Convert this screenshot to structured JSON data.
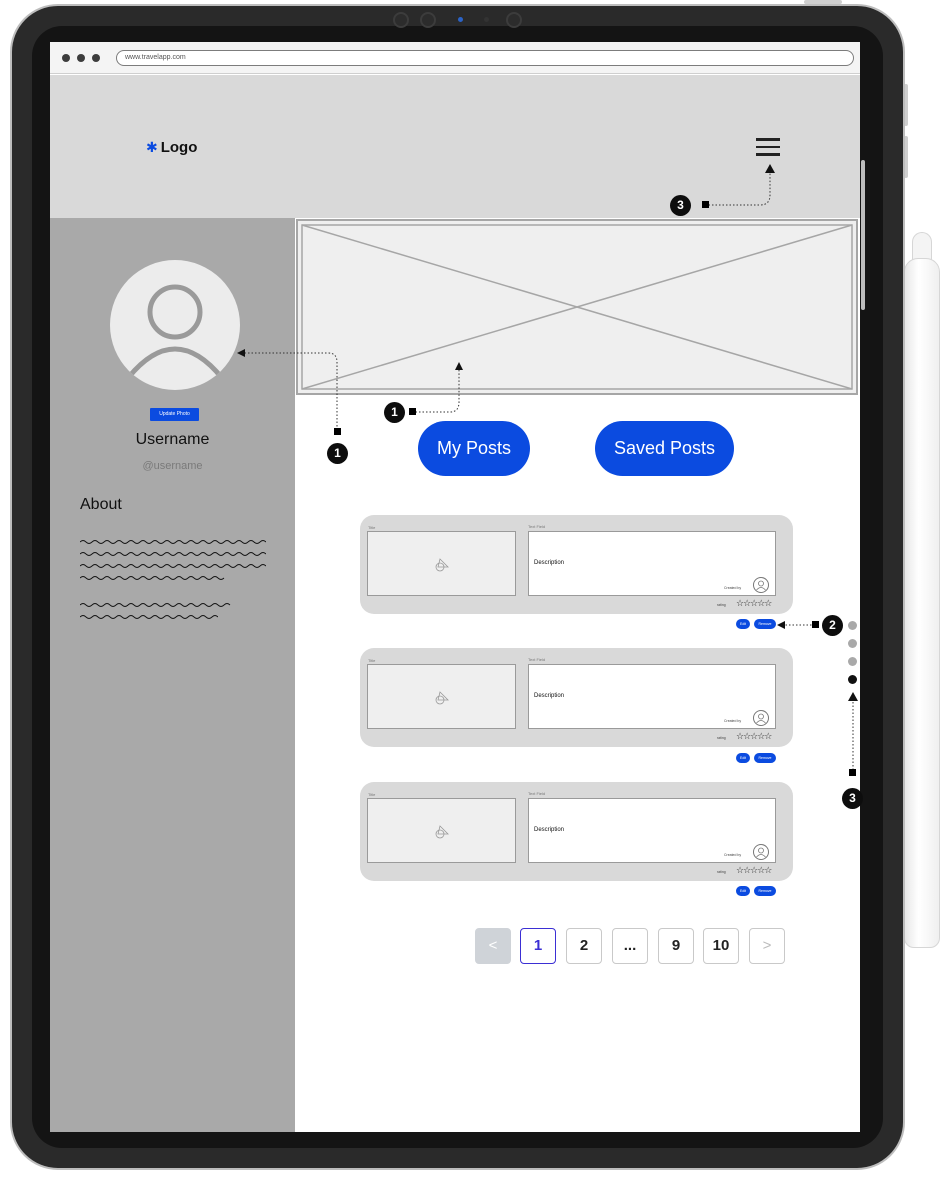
{
  "browser": {
    "url": "www.travelapp.com"
  },
  "header": {
    "logo_text": "Logo",
    "logo_icon": "asterisk-icon",
    "menu_icon": "hamburger-icon"
  },
  "sidebar": {
    "update_photo_label": "Update Photo",
    "username": "Username",
    "handle": "@username",
    "about_heading": "About"
  },
  "tabs": {
    "my_posts": "My Posts",
    "saved_posts": "Saved Posts"
  },
  "cards": [
    {
      "title_label": "Title",
      "text_field_label": "Text Field",
      "description": "Description",
      "created_by": "Created by",
      "rating_label": "rating",
      "stars": "☆☆☆☆☆",
      "edit_label": "Edit",
      "remove_label": "Remove"
    },
    {
      "title_label": "Title",
      "text_field_label": "Text Field",
      "description": "Description",
      "created_by": "Created by",
      "rating_label": "rating",
      "stars": "☆☆☆☆☆",
      "edit_label": "Edit",
      "remove_label": "Remove"
    },
    {
      "title_label": "Title",
      "text_field_label": "Text Field",
      "description": "Description",
      "created_by": "Created by",
      "rating_label": "rating",
      "stars": "☆☆☆☆☆",
      "edit_label": "Edit",
      "remove_label": "Remove"
    }
  ],
  "pagination": {
    "prev": "<",
    "pages": [
      "1",
      "2",
      "...",
      "9",
      "10"
    ],
    "next": ">",
    "current": "1"
  },
  "annotations": {
    "badge_1": "1",
    "badge_2": "2",
    "badge_3": "3"
  },
  "colors": {
    "accent": "#0b4be0",
    "sidebar": "#a9a9a9",
    "header": "#d9d9d9"
  }
}
